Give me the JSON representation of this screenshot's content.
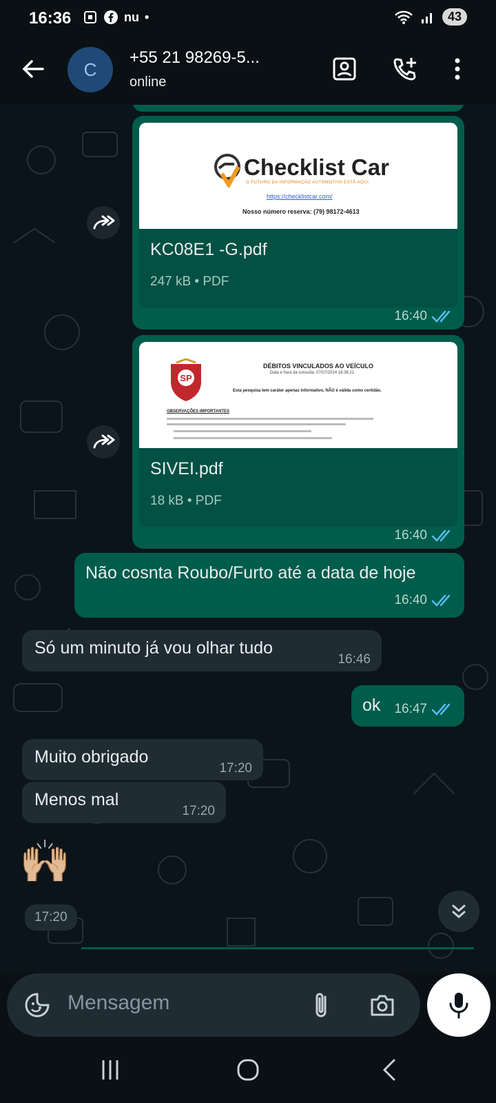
{
  "status_bar": {
    "time": "16:36",
    "carrier_text": "nu",
    "battery": "43"
  },
  "header": {
    "avatar_letter": "C",
    "contact_name": "+55 21 98269-5...",
    "status": "online"
  },
  "messages": [
    {
      "type": "document",
      "direction": "outgoing",
      "forwarded": true,
      "preview_brand": "Checklist Car",
      "preview_tagline": "O FUTURO DA INFORMAÇÃO AUTOMOTIVA ESTÁ AQUI",
      "preview_url": "https://checklistcar.com/",
      "preview_line": "Nosso número reserva: (79) 98172-4613",
      "filename": "KC08E1 -G.pdf",
      "meta": "247 kB • PDF",
      "time": "16:40"
    },
    {
      "type": "document",
      "direction": "outgoing",
      "forwarded": true,
      "preview_title": "DÉBITOS VINCULADOS AO VEÍCULO",
      "preview_sub": "Data e hora da consulta: 07/07/2024 16:38:21",
      "preview_note": "Esta pesquisa tem caráter apenas informativo, NÃO é válida como certidão.",
      "preview_obs": "OBSERVAÇÕES IMPORTANTES",
      "filename": "SIVEI.pdf",
      "meta": "18 kB • PDF",
      "time": "16:40"
    },
    {
      "type": "text",
      "direction": "outgoing",
      "text": "Não cosnta Roubo/Furto até a data de hoje",
      "time": "16:40"
    },
    {
      "type": "text",
      "direction": "incoming",
      "text": "Só um minuto já vou olhar tudo",
      "time": "16:46"
    },
    {
      "type": "text",
      "direction": "outgoing",
      "text": "ok",
      "time": "16:47"
    },
    {
      "type": "text",
      "direction": "incoming",
      "text": "Muito obrigado",
      "time": "17:20"
    },
    {
      "type": "text",
      "direction": "incoming",
      "text": "Menos mal",
      "time": "17:20"
    },
    {
      "type": "emoji",
      "direction": "incoming",
      "text": "🙌🏼",
      "time": "17:20"
    }
  ],
  "composer": {
    "placeholder": "Mensagem"
  },
  "colors": {
    "outgoing_bubble": "#005c4b",
    "incoming_bubble": "#202c33",
    "read_tick": "#53bdeb"
  }
}
